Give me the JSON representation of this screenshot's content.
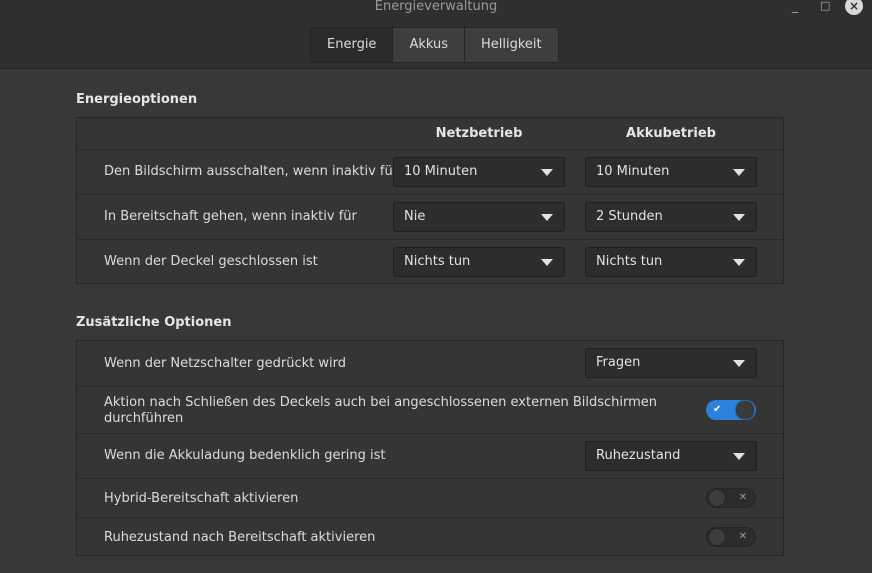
{
  "window": {
    "title": "Energieverwaltung",
    "minimize": "_",
    "maximize": "□",
    "close": "×"
  },
  "tabs": [
    "Energie",
    "Akkus",
    "Helligkeit"
  ],
  "power_options": {
    "title": "Energieoptionen",
    "col_ac": "Netzbetrieb",
    "col_battery": "Akkubetrieb",
    "rows": [
      {
        "label": "Den Bildschirm ausschalten, wenn inaktiv für",
        "ac": "10 Minuten",
        "battery": "10 Minuten"
      },
      {
        "label": "In Bereitschaft gehen, wenn inaktiv für",
        "ac": "Nie",
        "battery": "2 Stunden"
      },
      {
        "label": "Wenn der Deckel geschlossen ist",
        "ac": "Nichts tun",
        "battery": "Nichts tun"
      }
    ]
  },
  "extra_options": {
    "title": "Zusätzliche Optionen",
    "power_button": {
      "label": "Wenn der Netzschalter gedrückt wird",
      "value": "Fragen"
    },
    "lid_external": {
      "label_line1": "Aktion nach Schließen des Deckels auch bei angeschlossenen externen Bildschirmen",
      "label_line2": "durchführen",
      "enabled": true,
      "mark": "✔"
    },
    "critical_battery": {
      "label": "Wenn die Akkuladung bedenklich gering ist",
      "value": "Ruhezustand"
    },
    "hybrid_sleep": {
      "label": "Hybrid-Bereitschaft aktivieren",
      "enabled": false,
      "mark": "✕"
    },
    "hibernate_after_sleep": {
      "label": "Ruhezustand nach Bereitschaft aktivieren",
      "enabled": false,
      "mark": "✕"
    }
  },
  "colors": {
    "accent": "#2a82da",
    "background": "#383838",
    "panel": "#353535"
  }
}
